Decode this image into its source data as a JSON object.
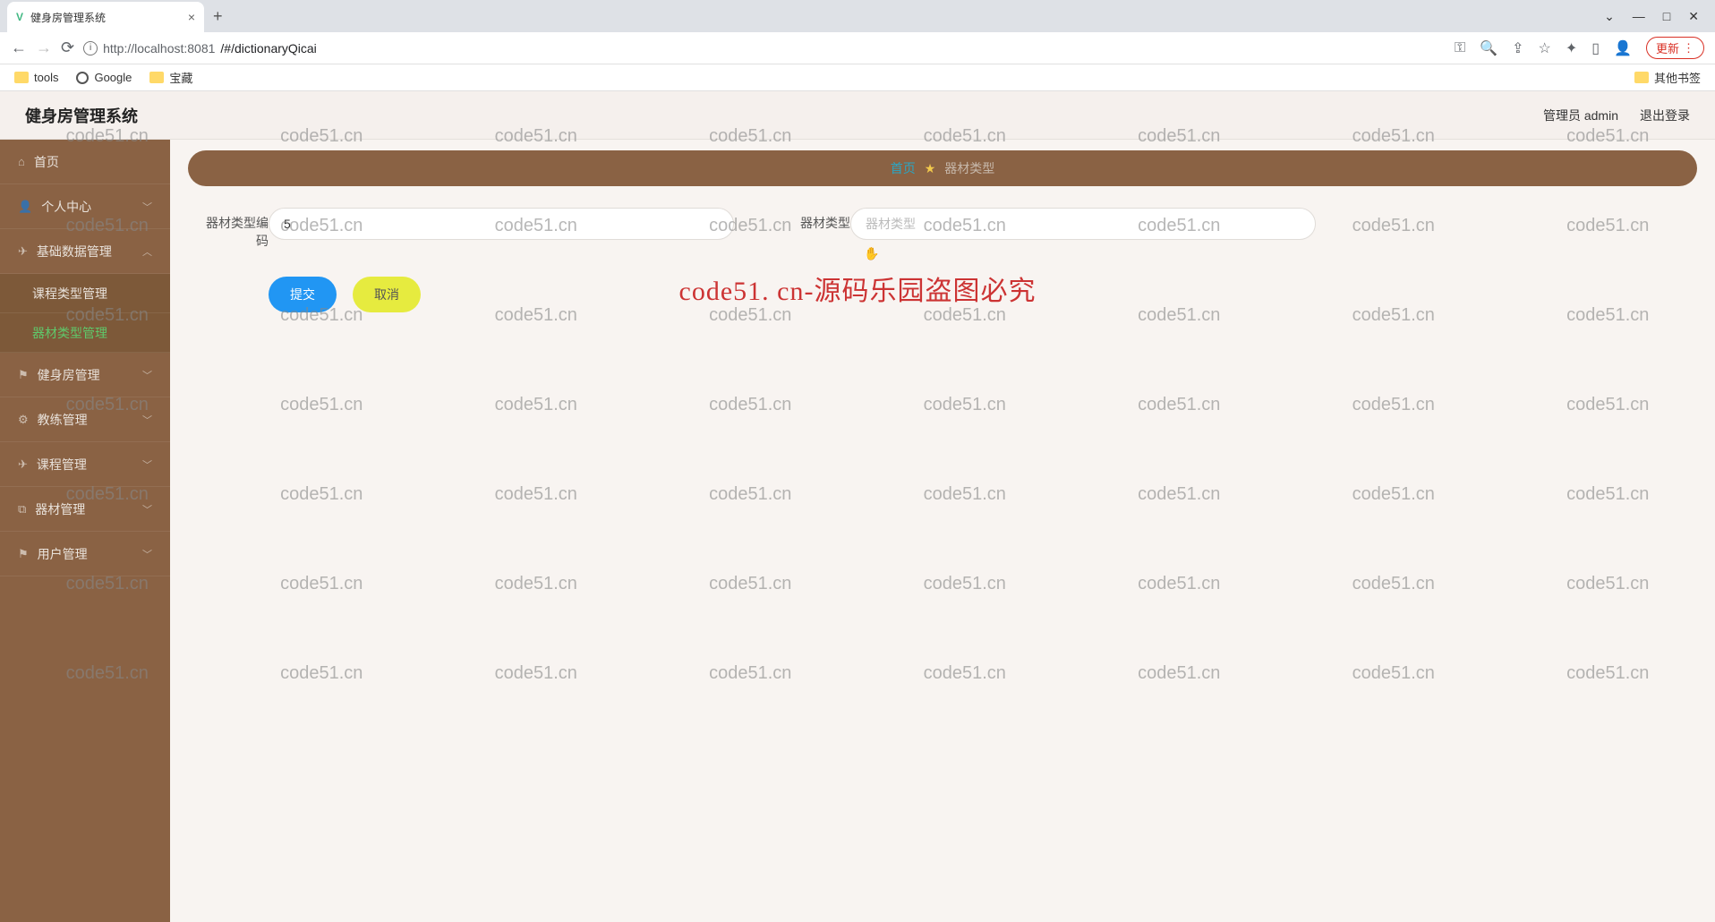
{
  "browser": {
    "tab_title": "健身房管理系统",
    "url_host": "http://localhost:8081",
    "url_path": "/#/dictionaryQicai",
    "update_label": "更新",
    "bookmarks": {
      "tools": "tools",
      "google": "Google",
      "treasure": "宝藏",
      "other": "其他书签"
    }
  },
  "header": {
    "title": "健身房管理系统",
    "admin": "管理员 admin",
    "logout": "退出登录"
  },
  "sidebar": {
    "home": "首页",
    "personal": "个人中心",
    "basic_data": "基础数据管理",
    "course_type": "课程类型管理",
    "equip_type": "器材类型管理",
    "gym": "健身房管理",
    "coach": "教练管理",
    "course": "课程管理",
    "equipment": "器材管理",
    "user": "用户管理"
  },
  "breadcrumb": {
    "home": "首页",
    "current": "器材类型"
  },
  "form": {
    "code_label": "器材类型编码",
    "code_value": "5",
    "type_label": "器材类型",
    "type_placeholder": "器材类型",
    "submit": "提交",
    "cancel": "取消"
  },
  "watermark": {
    "text": "code51.cn",
    "center": "code51. cn-源码乐园盗图必究"
  }
}
